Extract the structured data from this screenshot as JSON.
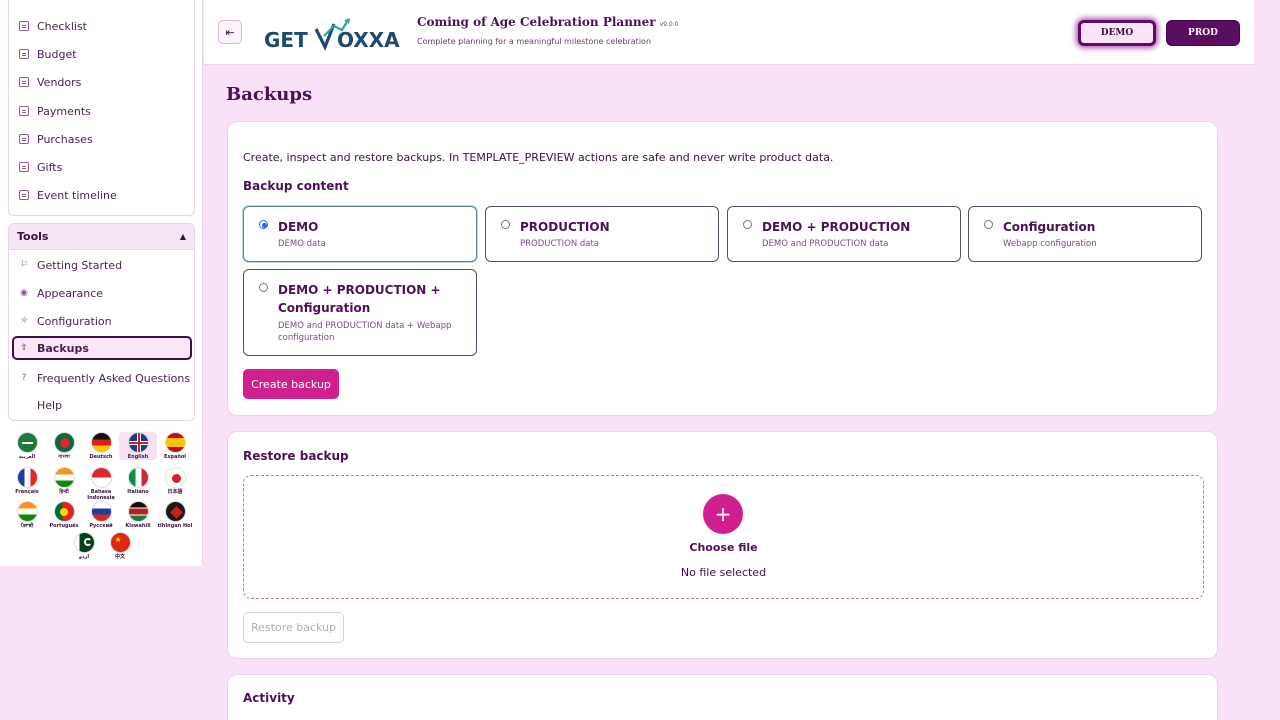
{
  "sidebar": {
    "items": [
      {
        "label": "Checklist",
        "icon": "document-icon"
      },
      {
        "label": "Budget",
        "icon": "document-icon"
      },
      {
        "label": "Vendors",
        "icon": "document-icon"
      },
      {
        "label": "Payments",
        "icon": "document-icon"
      },
      {
        "label": "Purchases",
        "icon": "document-icon"
      },
      {
        "label": "Gifts",
        "icon": "document-icon"
      },
      {
        "label": "Event timeline",
        "icon": "document-icon"
      }
    ],
    "tools": {
      "title": "Tools",
      "items": [
        {
          "label": "Getting Started",
          "icon": "flag-outline-icon"
        },
        {
          "label": "Appearance",
          "icon": "palette-icon"
        },
        {
          "label": "Configuration",
          "icon": "gear-icon"
        },
        {
          "label": "Backups",
          "icon": "upload-icon"
        },
        {
          "label": "Frequently Asked Questions",
          "icon": "question-circle-icon"
        },
        {
          "label": "Help",
          "icon": ""
        }
      ]
    },
    "languages": [
      {
        "label": "العربية",
        "code": "ar"
      },
      {
        "label": "বাংলা",
        "code": "bn"
      },
      {
        "label": "Deutsch",
        "code": "de"
      },
      {
        "label": "English",
        "code": "en"
      },
      {
        "label": "Español",
        "code": "es"
      },
      {
        "label": "Français",
        "code": "fr"
      },
      {
        "label": "हिन्दी",
        "code": "hi"
      },
      {
        "label": "Bahasa Indonesia",
        "code": "id"
      },
      {
        "label": "Italiano",
        "code": "it"
      },
      {
        "label": "日本語",
        "code": "ja"
      },
      {
        "label": "ਪੰਜਾਬੀ",
        "code": "pa"
      },
      {
        "label": "Português",
        "code": "pt"
      },
      {
        "label": "Русский",
        "code": "ru"
      },
      {
        "label": "Kiswahili",
        "code": "sw"
      },
      {
        "label": "tlhIngan Hol",
        "code": "tlh"
      },
      {
        "label": "اردو",
        "code": "ur"
      },
      {
        "label": "中文",
        "code": "zh"
      }
    ]
  },
  "header": {
    "title": "Coming of Age Celebration Planner",
    "version": "v9.0.0",
    "subtitle": "Complete planning for a meaningful milestone celebration",
    "env_demo": "DEMO",
    "env_prod": "PROD"
  },
  "page": {
    "title": "Backups"
  },
  "backup": {
    "description": "Create, inspect and restore backups. In TEMPLATE_PREVIEW actions are safe and never write product data.",
    "content_title": "Backup content",
    "options": [
      {
        "title": "DEMO",
        "subtitle": "DEMO data",
        "selected": true
      },
      {
        "title": "PRODUCTION",
        "subtitle": "PRODUCTION data",
        "selected": false
      },
      {
        "title": "DEMO + PRODUCTION",
        "subtitle": "DEMO and PRODUCTION data",
        "selected": false
      },
      {
        "title": "Configuration",
        "subtitle": "Webapp configuration",
        "selected": false
      },
      {
        "title": "DEMO + PRODUCTION + Configuration",
        "subtitle": "DEMO and PRODUCTION data + Webapp configuration",
        "selected": false
      }
    ],
    "create_label": "Create backup"
  },
  "restore": {
    "title": "Restore backup",
    "choose_label": "Choose file",
    "no_file": "No file selected",
    "restore_label": "Restore backup"
  },
  "activity": {
    "title": "Activity"
  },
  "colors": {
    "accent": "#d0208f",
    "brand_dark": "#5b0d5f",
    "background": "#f9e1f7"
  }
}
